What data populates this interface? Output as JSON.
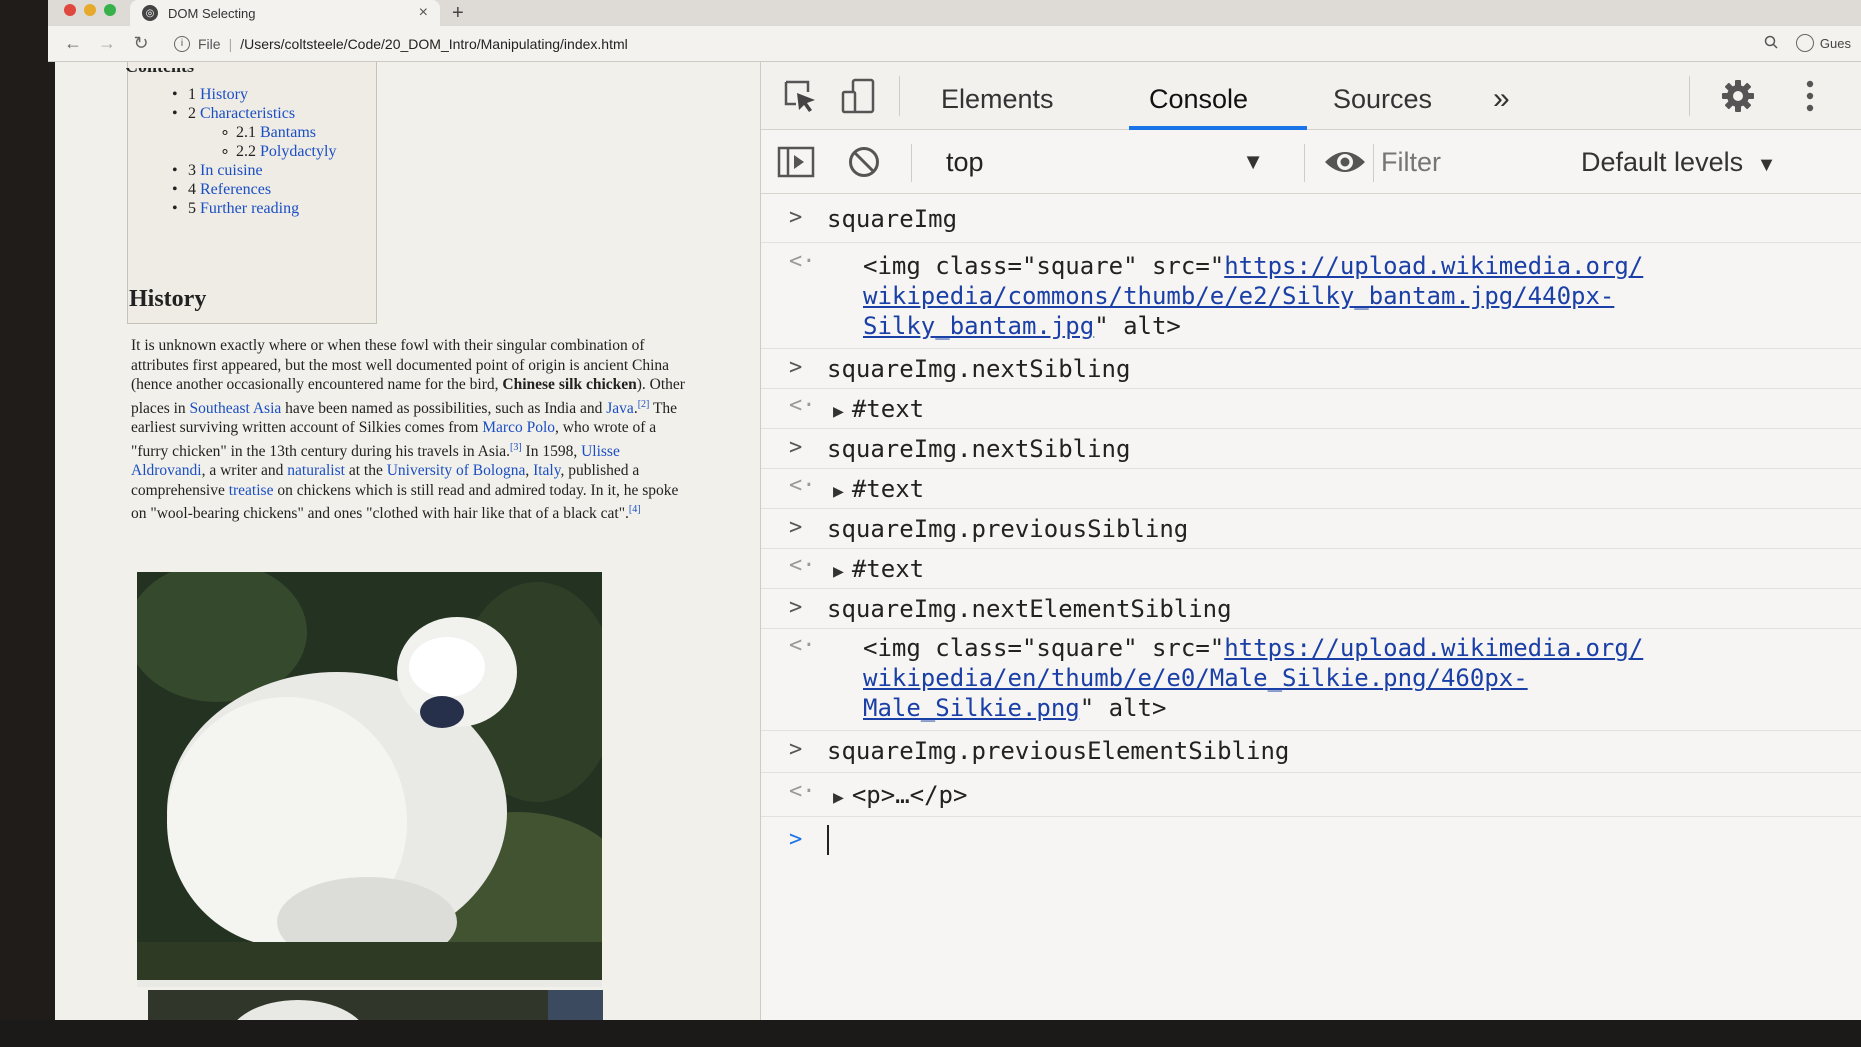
{
  "browser": {
    "tab_title": "DOM Selecting",
    "tab_close": "×",
    "new_tab": "+",
    "address": {
      "protocol": "File",
      "separator": "|",
      "path": "/Users/coltsteele/Code/20_DOM_Intro/Manipulating/index.html"
    },
    "profile_label": "Gues"
  },
  "webpage": {
    "toc": {
      "heading": "Contents",
      "items": [
        {
          "num": "1",
          "label": "History"
        },
        {
          "num": "2",
          "label": "Characteristics"
        },
        {
          "num": "2.1",
          "label": "Bantams"
        },
        {
          "num": "2.2",
          "label": "Polydactyly"
        },
        {
          "num": "3",
          "label": "In cuisine"
        },
        {
          "num": "4",
          "label": "References"
        },
        {
          "num": "5",
          "label": "Further reading"
        }
      ]
    },
    "section_heading": "History",
    "paragraph": {
      "t1": "It is unknown exactly where or when these fowl with their singular combination of attributes first appeared, but the most well documented point of origin is ancient China (hence another occasionally encountered name for the bird, ",
      "bold": "Chinese silk chicken",
      "t2": "). Other places in ",
      "link_southeast": "Southeast Asia",
      "t3": " have been named as possibilities, such as India and ",
      "link_java": "Java",
      "ref2": "[2]",
      "t4": " The earliest surviving written account of Silkies comes from ",
      "link_marco": "Marco Polo",
      "t5": ", who wrote of a \"furry chicken\" in the 13th century during his travels in Asia.",
      "ref3": "[3]",
      "t6": " In 1598, ",
      "link_ulisse": "Ulisse Aldrovandi",
      "t7": ", a writer and ",
      "link_naturalist": "naturalist",
      "t8": " at the ",
      "link_univ": "University of Bologna",
      "t9": ", ",
      "link_italy": "Italy",
      "t10": ", published a comprehensive ",
      "link_treatise": "treatise",
      "t11": " on chickens which is still read and admired today. In it, he spoke on \"wool-bearing chickens\" and ones \"clothed with hair like that of a black cat\".",
      "ref4": "[4]"
    }
  },
  "devtools": {
    "tabs": [
      "Elements",
      "Console",
      "Sources"
    ],
    "active_tab": "Console",
    "more_tabs": "»",
    "context": "top",
    "filter_placeholder": "Filter",
    "levels_label": "Default levels",
    "console": [
      {
        "input": "squareImg",
        "output": {
          "pre": "<img class=\"square\" src=\"",
          "url1": "https://upload.wikimedia.org/",
          "url2": "wikipedia/commons/thumb/e/e2/Silky_bantam.jpg/440px-",
          "url3": "Silky_bantam.jpg",
          "post": "\" alt>"
        }
      },
      {
        "input": "squareImg.nextSibling",
        "output_node": "#text"
      },
      {
        "input": "squareImg.nextSibling",
        "output_node": "#text"
      },
      {
        "input": "squareImg.previousSibling",
        "output_node": "#text"
      },
      {
        "input": "squareImg.nextElementSibling",
        "output": {
          "pre": "<img class=\"square\" src=\"",
          "url1": "https://upload.wikimedia.org/",
          "url2": "wikipedia/en/thumb/e/e0/Male_Silkie.png/460px-",
          "url3": "Male_Silkie.png",
          "post": "\" alt>"
        }
      },
      {
        "input": "squareImg.previousElementSibling",
        "output_node": "<p>…</p>"
      }
    ]
  },
  "colors": {
    "accent": "#1a73e8",
    "link": "#1a4ec4",
    "console_link": "#1a3fa6"
  }
}
